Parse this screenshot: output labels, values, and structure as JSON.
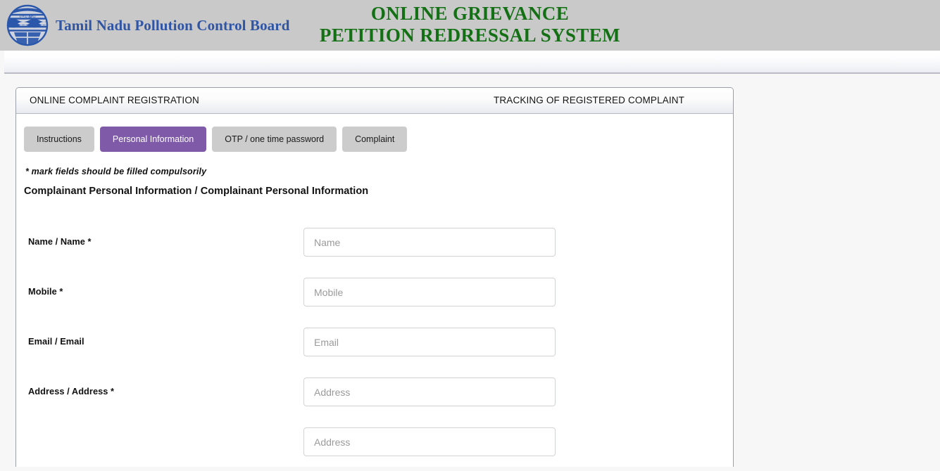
{
  "masthead": {
    "logo_icon": "tnpcb-globe-logo-icon",
    "brand_name": "Tamil Nadu Pollution Control Board",
    "title_line1": "ONLINE GRIEVANCE",
    "title_line2": "PETITION REDRESSAL SYSTEM",
    "brand_color": "#2f55a4",
    "title_color": "#137014",
    "background_color": "#c9c9c9"
  },
  "panel": {
    "header": {
      "left_label": "ONLINE COMPLAINT REGISTRATION",
      "right_label": "TRACKING OF REGISTERED COMPLAINT"
    },
    "tabs": [
      {
        "label": "Instructions",
        "active": false
      },
      {
        "label": "Personal Information",
        "active": true
      },
      {
        "label": "OTP / one time password",
        "active": false
      },
      {
        "label": "Complaint",
        "active": false
      }
    ],
    "active_tab_color": "#7e5aa9",
    "inactive_tab_color": "#cccccc",
    "compulsory_note": "* mark fields should be filled compulsorily",
    "section_title": "Complainant Personal Information / Complainant Personal Information",
    "fields": [
      {
        "label": "Name / Name *",
        "placeholder": "Name",
        "value": ""
      },
      {
        "label": "Mobile *",
        "placeholder": "Mobile",
        "value": ""
      },
      {
        "label": "Email / Email",
        "placeholder": "Email",
        "value": ""
      },
      {
        "label": "Address / Address *",
        "placeholder": "Address",
        "value": ""
      },
      {
        "label": "",
        "placeholder": "Address",
        "value": ""
      }
    ]
  }
}
